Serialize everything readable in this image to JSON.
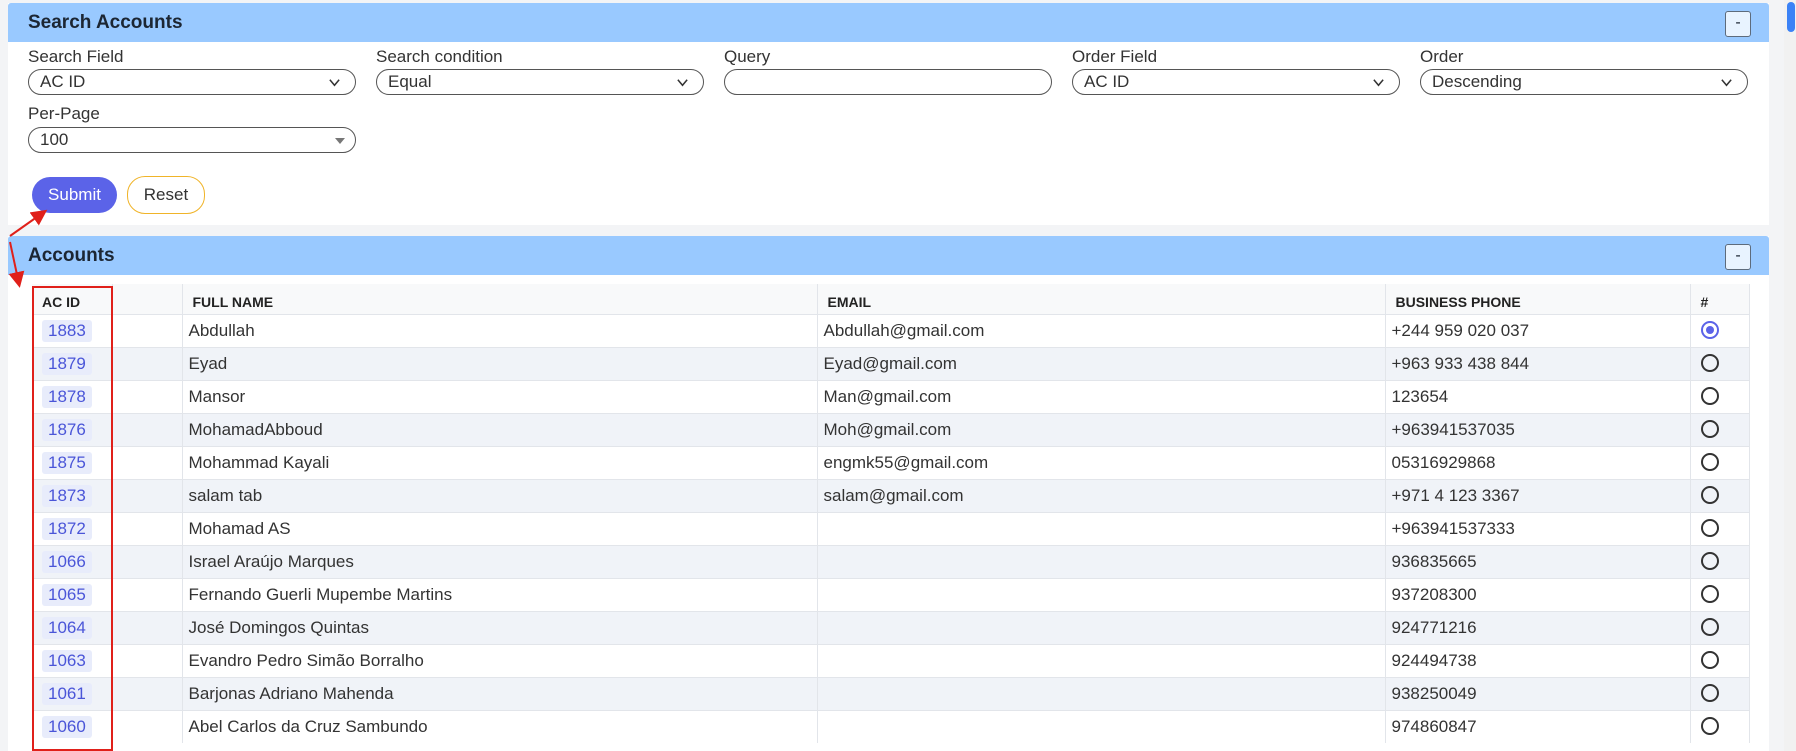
{
  "search_panel": {
    "title": "Search Accounts",
    "collapse_label": "-",
    "fields": {
      "search_field": {
        "label": "Search Field",
        "value": "AC ID"
      },
      "search_condition": {
        "label": "Search condition",
        "value": "Equal"
      },
      "query": {
        "label": "Query",
        "value": ""
      },
      "order_field": {
        "label": "Order Field",
        "value": "AC ID"
      },
      "order": {
        "label": "Order",
        "value": "Descending"
      },
      "per_page": {
        "label": "Per-Page",
        "value": "100"
      }
    },
    "submit_label": "Submit",
    "reset_label": "Reset"
  },
  "accounts_panel": {
    "title": "Accounts",
    "collapse_label": "-",
    "columns": [
      "AC ID",
      "",
      "FULL NAME",
      "EMAIL",
      "BUSINESS PHONE",
      "#"
    ],
    "rows": [
      {
        "id": "1883",
        "name": "Abdullah",
        "email": "Abdullah@gmail.com",
        "phone": "+244 959 020 037",
        "selected": true
      },
      {
        "id": "1879",
        "name": "Eyad",
        "email": "Eyad@gmail.com",
        "phone": "+963 933 438 844",
        "selected": false
      },
      {
        "id": "1878",
        "name": "Mansor",
        "email": "Man@gmail.com",
        "phone": "123654",
        "selected": false
      },
      {
        "id": "1876",
        "name": "MohamadAbboud",
        "email": "Moh@gmail.com",
        "phone": "+963941537035",
        "selected": false
      },
      {
        "id": "1875",
        "name": "Mohammad Kayali",
        "email": "engmk55@gmail.com",
        "phone": "05316929868",
        "selected": false
      },
      {
        "id": "1873",
        "name": "salam tab",
        "email": "salam@gmail.com",
        "phone": "+971 4 123 3367",
        "selected": false
      },
      {
        "id": "1872",
        "name": "Mohamad AS",
        "email": "",
        "phone": "+963941537333",
        "selected": false
      },
      {
        "id": "1066",
        "name": "Israel Araújo Marques",
        "email": "",
        "phone": "936835665",
        "selected": false
      },
      {
        "id": "1065",
        "name": "Fernando Guerli Mupembe Martins",
        "email": "",
        "phone": "937208300",
        "selected": false
      },
      {
        "id": "1064",
        "name": "José Domingos Quintas",
        "email": "",
        "phone": "924771216",
        "selected": false
      },
      {
        "id": "1063",
        "name": "Evandro Pedro Simão Borralho",
        "email": "",
        "phone": "924494738",
        "selected": false
      },
      {
        "id": "1061",
        "name": "Barjonas Adriano Mahenda",
        "email": "",
        "phone": "938250049",
        "selected": false
      },
      {
        "id": "1060",
        "name": "Abel Carlos da Cruz Sambundo",
        "email": "",
        "phone": "974860847",
        "selected": false
      }
    ]
  },
  "colors": {
    "header_bg": "#99c9ff",
    "primary": "#5b63e8",
    "annotation": "#e0201a",
    "reset_border": "#f0b429"
  }
}
